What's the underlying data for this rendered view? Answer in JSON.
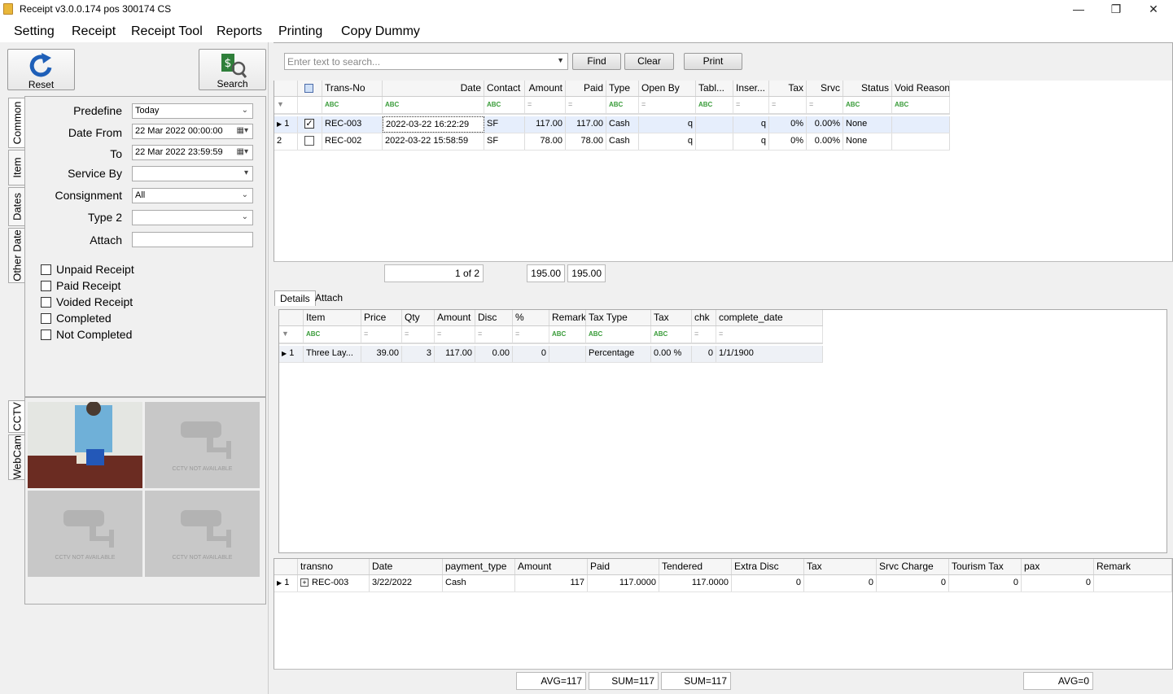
{
  "window": {
    "title": "Receipt v3.0.0.174 pos 300174 CS"
  },
  "menu": [
    "Setting",
    "Receipt",
    "Receipt Tool",
    "Reports",
    "Printing",
    "Copy Dummy"
  ],
  "toolbar": {
    "reset_label": "Reset",
    "search_label": "Search"
  },
  "left_tabs": [
    "Common",
    "Item",
    "Dates",
    "Other Date"
  ],
  "filters": {
    "predefine_label": "Predefine",
    "predefine_value": "Today",
    "date_from_label": "Date From",
    "date_from_value": "22 Mar 2022 00:00:00",
    "to_label": "To",
    "to_value": "22 Mar 2022 23:59:59",
    "service_by_label": "Service By",
    "service_by_value": "",
    "consignment_label": "Consignment",
    "consignment_value": "All",
    "type2_label": "Type 2",
    "type2_value": "",
    "attach_label": "Attach",
    "attach_value": ""
  },
  "checkboxes": [
    "Unpaid Receipt",
    "Paid Receipt",
    "Voided Receipt",
    "Completed",
    "Not Completed"
  ],
  "cam_tabs": [
    "CCTV",
    "WebCam"
  ],
  "cam_na_text": "CCTV NOT AVAILABLE",
  "search": {
    "placeholder": "Enter text to search...",
    "find_label": "Find",
    "clear_label": "Clear",
    "print_label": "Print"
  },
  "receipts": {
    "columns": [
      "Trans-No",
      "Date",
      "Contact",
      "Amount",
      "Paid",
      "Type",
      "Open By",
      "Tabl...",
      "Inser...",
      "Tax",
      "Srvc",
      "Status",
      "Void Reason"
    ],
    "rows": [
      {
        "idx": "1",
        "checked": true,
        "trans_no": "REC-003",
        "date": "2022-03-22 16:22:29",
        "contact": "SF",
        "amount": "117.00",
        "paid": "117.00",
        "type": "Cash",
        "open_by": "q",
        "table": "",
        "inser": "q",
        "tax": "0%",
        "srvc": "0.00%",
        "status": "None",
        "void": ""
      },
      {
        "idx": "2",
        "checked": false,
        "trans_no": "REC-002",
        "date": "2022-03-22 15:58:59",
        "contact": "SF",
        "amount": "78.00",
        "paid": "78.00",
        "type": "Cash",
        "open_by": "q",
        "table": "",
        "inser": "q",
        "tax": "0%",
        "srvc": "0.00%",
        "status": "None",
        "void": ""
      }
    ],
    "footer": {
      "page": "1 of 2",
      "amount_total": "195.00",
      "paid_total": "195.00"
    }
  },
  "detail_tabs": [
    "Details",
    "Attach"
  ],
  "details": {
    "columns": [
      "Item",
      "Price",
      "Qty",
      "Amount",
      "Disc",
      "%",
      "Remark",
      "Tax Type",
      "Tax",
      "chk",
      "complete_date"
    ],
    "rows": [
      {
        "idx": "1",
        "item": "Three Lay...",
        "price": "39.00",
        "qty": "3",
        "amount": "117.00",
        "disc": "0.00",
        "pct": "0",
        "remark": "",
        "tax_type": "Percentage",
        "tax": "0.00 %",
        "chk": "0",
        "complete_date": "1/1/1900"
      }
    ]
  },
  "payments": {
    "columns": [
      "transno",
      "Date",
      "payment_type",
      "Amount",
      "Paid",
      "Tendered",
      "Extra Disc",
      "Tax",
      "Srvc Charge",
      "Tourism Tax",
      "pax",
      "Remark"
    ],
    "rows": [
      {
        "idx": "1",
        "transno": "REC-003",
        "date": "3/22/2022",
        "payment_type": "Cash",
        "amount": "117",
        "paid": "117.0000",
        "tendered": "117.0000",
        "extra_disc": "0",
        "tax": "0",
        "srvc": "0",
        "tourism": "0",
        "pax": "0",
        "remark": ""
      }
    ],
    "footer": {
      "amount": "AVG=117",
      "paid": "SUM=117",
      "tendered": "SUM=117",
      "pax": "AVG=0"
    }
  }
}
